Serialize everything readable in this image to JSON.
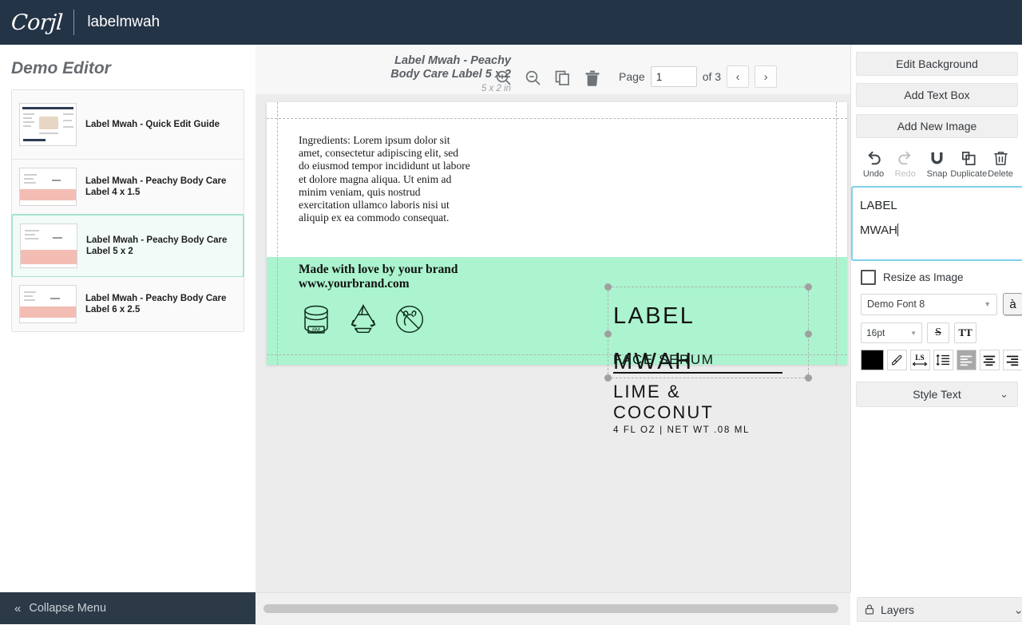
{
  "header": {
    "logo": "Corjl",
    "title": "labelmwah"
  },
  "sidebar": {
    "title": "Demo Editor",
    "items": [
      {
        "label": "Label Mwah - Quick Edit Guide",
        "type": "guide",
        "selected": false
      },
      {
        "label": "Label Mwah - Peachy Body Care Label 4 x 1.5",
        "type": "label",
        "selected": false
      },
      {
        "label": "Label Mwah - Peachy Body Care Label 5 x 2",
        "type": "label",
        "selected": true
      },
      {
        "label": "Label Mwah - Peachy Body Care Label 6 x 2.5",
        "type": "label",
        "selected": false
      }
    ],
    "collapse_label": "Collapse Menu",
    "collapse_icon": "double-chevron-left-icon"
  },
  "toolbar": {
    "doc_title": "Label Mwah - Peachy Body Care Label 5 x 2",
    "doc_size": "5 x 2 in",
    "zoom_in_icon": "zoom-in-icon",
    "zoom_out_icon": "zoom-out-icon",
    "duplicate_icon": "duplicate-icon",
    "delete_icon": "trash-icon",
    "page_label": "Page",
    "page_value": "1",
    "page_of": "of 3",
    "prev_label": "‹",
    "next_label": "›"
  },
  "canvas": {
    "band_color": "#abf4cf",
    "ingredients": "Ingredients: Lorem ipsum dolor sit amet, consectetur adipiscing elit, sed do eiusmod tempor incididunt ut labore et dolore magna aliqua. Ut enim ad minim veniam, quis nostrud exercitation ullamco laboris nisi ut aliquip ex ea commodo consequat.",
    "brand_line1": "Made with love by your brand",
    "brand_line2": "www.yourbrand.com",
    "care_icons": [
      {
        "name": "period-after-opening-icon",
        "text": "6M"
      },
      {
        "name": "recycle-icon",
        "text": ""
      },
      {
        "name": "cruelty-free-icon",
        "text": ""
      }
    ],
    "selected_text_line1": "LABEL",
    "selected_text_line2": "MWAH",
    "face_serum": "FACE SERUM",
    "product_line1": "LIME &",
    "product_line2": "COCONUT",
    "net_weight": "4 FL OZ | NET WT .08 ML"
  },
  "right_panel": {
    "edit_background": "Edit Background",
    "add_text_box": "Add Text Box",
    "add_new_image": "Add New Image",
    "actions": [
      {
        "label": "Undo",
        "icon": "undo-icon",
        "disabled": false
      },
      {
        "label": "Redo",
        "icon": "redo-icon",
        "disabled": true
      },
      {
        "label": "Snap",
        "icon": "magnet-icon",
        "disabled": false
      },
      {
        "label": "Duplicate",
        "icon": "duplicate-icon",
        "disabled": false
      },
      {
        "label": "Delete",
        "icon": "trash-icon",
        "disabled": false
      }
    ],
    "text_value_line1": "LABEL",
    "text_value_line2": "MWAH",
    "resize_as_image": "Resize as Image",
    "font_name": "Demo Font 8",
    "accent_char": "à",
    "font_size": "16pt",
    "strikethrough_label": "S",
    "caps_label": "TT",
    "color_value": "#000000",
    "eyedropper_icon": "eyedropper-icon",
    "letter_spacing_label": "LS",
    "line_height_icon": "line-height-icon",
    "align_left_icon": "align-left-icon",
    "align_center_icon": "align-center-icon",
    "align_right_icon": "align-right-icon",
    "style_text": "Style Text",
    "style_text_chevron": "⌄",
    "layers_label": "Layers",
    "layers_lock_icon": "lock-icon",
    "layers_chevron": "⌄",
    "accent_color": "#7fd0ea"
  }
}
